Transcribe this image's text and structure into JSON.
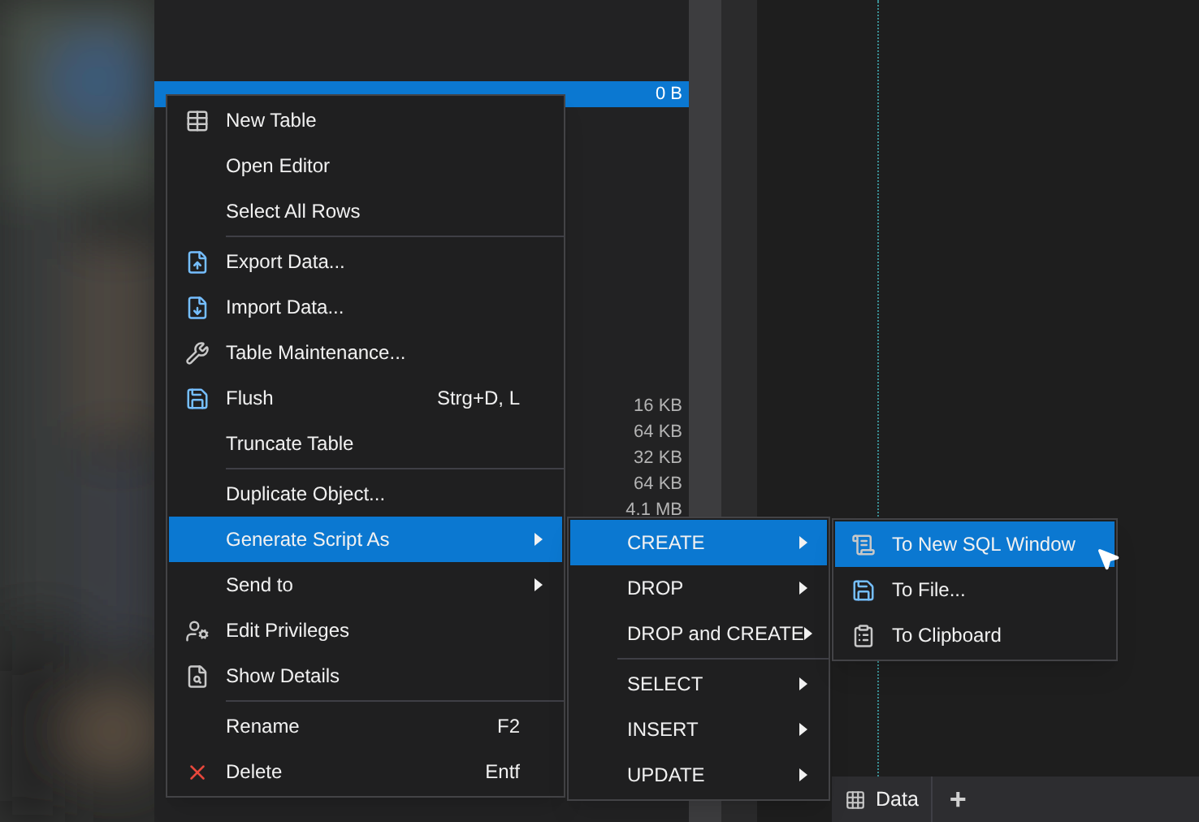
{
  "object_list": {
    "rows": [
      {
        "size": "0 B",
        "selected": true
      },
      {
        "selected": false
      },
      {
        "selected": false
      },
      {
        "selected": false
      },
      {
        "selected": false
      },
      {
        "selected": false
      },
      {
        "selected": false
      },
      {
        "selected": false
      },
      {
        "selected": false
      },
      {
        "selected": false
      },
      {
        "selected": false
      },
      {
        "selected": false
      },
      {
        "size": "16 KB",
        "selected": false
      },
      {
        "size": "64 KB",
        "selected": false
      },
      {
        "size": "32 KB",
        "selected": false
      },
      {
        "size": "64 KB",
        "selected": false
      },
      {
        "size": "4.1 MB",
        "selected": false
      }
    ]
  },
  "context_menu": [
    {
      "kind": "item",
      "label": "New Table",
      "selected": false
    },
    {
      "kind": "item",
      "label": "Open Editor",
      "selected": false
    },
    {
      "kind": "item",
      "label": "Select All Rows",
      "selected": false
    },
    {
      "kind": "separator"
    },
    {
      "kind": "item",
      "label": "Export Data...",
      "selected": false
    },
    {
      "kind": "item",
      "label": "Import Data...",
      "selected": false
    },
    {
      "kind": "item",
      "label": "Table Maintenance...",
      "selected": false
    },
    {
      "kind": "item",
      "label": "Flush",
      "shortcut": "Strg+D, L",
      "selected": false
    },
    {
      "kind": "item",
      "label": "Truncate Table",
      "selected": false
    },
    {
      "kind": "separator"
    },
    {
      "kind": "item",
      "label": "Duplicate Object...",
      "selected": false
    },
    {
      "kind": "item",
      "label": "Generate Script As",
      "submenu": true,
      "selected": true
    },
    {
      "kind": "item",
      "label": "Send to",
      "submenu": true,
      "selected": false
    },
    {
      "kind": "item",
      "label": "Edit Privileges",
      "selected": false
    },
    {
      "kind": "item",
      "label": "Show Details",
      "selected": false
    },
    {
      "kind": "separator"
    },
    {
      "kind": "item",
      "label": "Rename",
      "shortcut": "F2",
      "selected": false
    },
    {
      "kind": "item",
      "label": "Delete",
      "shortcut": "Entf",
      "selected": false
    }
  ],
  "script_submenu": [
    {
      "kind": "item",
      "label": "CREATE",
      "submenu": true,
      "selected": true
    },
    {
      "kind": "item",
      "label": "DROP",
      "submenu": true,
      "selected": false
    },
    {
      "kind": "item",
      "label": "DROP and CREATE",
      "submenu": true,
      "selected": false
    },
    {
      "kind": "separator"
    },
    {
      "kind": "item",
      "label": "SELECT",
      "submenu": true,
      "selected": false
    },
    {
      "kind": "item",
      "label": "INSERT",
      "submenu": true,
      "selected": false
    },
    {
      "kind": "item",
      "label": "UPDATE",
      "submenu": true,
      "selected": false
    }
  ],
  "create_submenu": [
    {
      "kind": "item",
      "label": "To New SQL Window",
      "selected": true
    },
    {
      "kind": "item",
      "label": "To File...",
      "selected": false
    },
    {
      "kind": "item",
      "label": "To Clipboard",
      "selected": false
    }
  ],
  "bottom_tabs": [
    {
      "label": "Data"
    }
  ],
  "add_tab_button": "+"
}
